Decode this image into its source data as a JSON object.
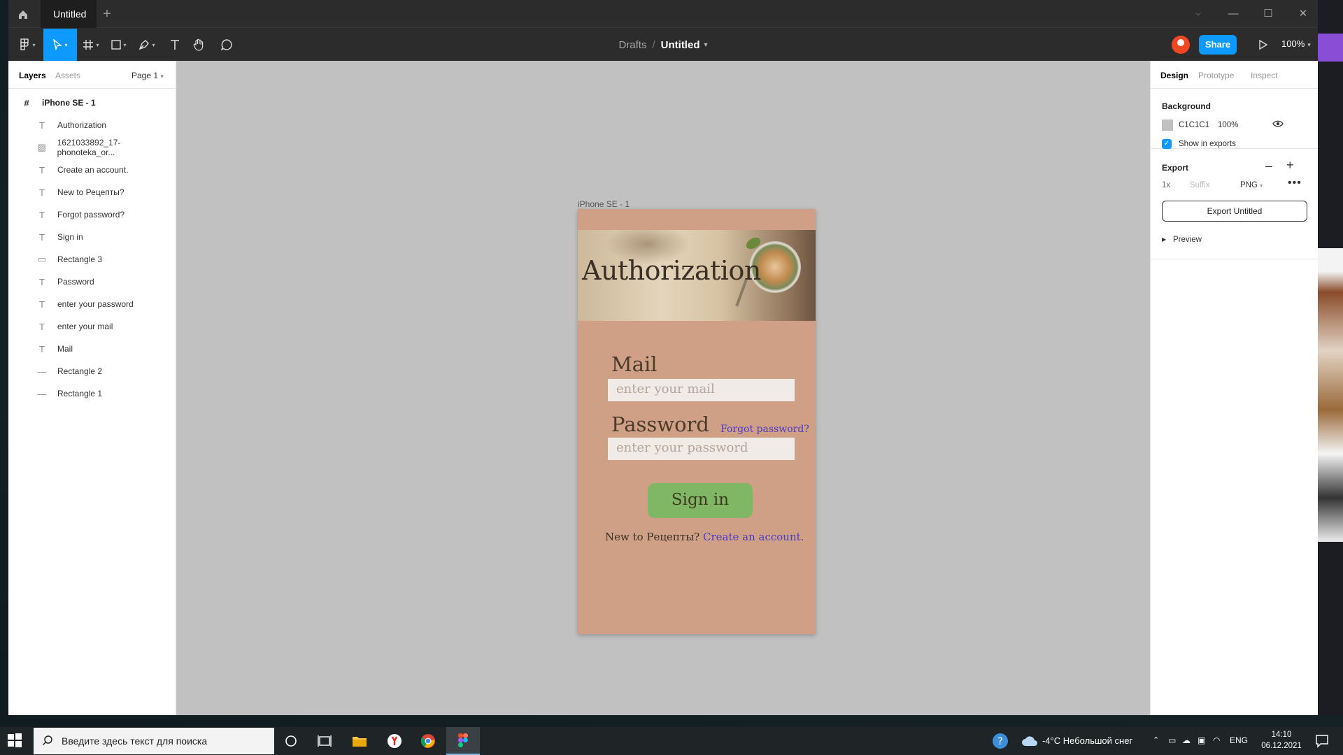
{
  "window": {
    "tab_title": "Untitled",
    "controls": {
      "minimize": "—",
      "maximize": "☐",
      "close": "✕"
    }
  },
  "toolbar": {
    "breadcrumb_drafts": "Drafts",
    "breadcrumb_sep": "/",
    "file_name": "Untitled",
    "share_label": "Share",
    "zoom_label": "100%"
  },
  "left_panel": {
    "tabs": [
      "Layers",
      "Assets"
    ],
    "page_selector": "Page 1",
    "frame_name": "iPhone SE - 1",
    "layers": [
      {
        "name": "Authorization",
        "icon": "text-icon"
      },
      {
        "name": "1621033892_17-phonoteka_or...",
        "icon": "image-icon"
      },
      {
        "name": "Create an account.",
        "icon": "text-icon"
      },
      {
        "name": "New to Рецепты?",
        "icon": "text-icon"
      },
      {
        "name": "Forgot password?",
        "icon": "text-icon"
      },
      {
        "name": "Sign in",
        "icon": "text-icon"
      },
      {
        "name": "Rectangle 3",
        "icon": "rectangle-icon"
      },
      {
        "name": "Password",
        "icon": "text-icon"
      },
      {
        "name": "enter your password",
        "icon": "text-icon"
      },
      {
        "name": "enter your mail",
        "icon": "text-icon"
      },
      {
        "name": "Mail",
        "icon": "text-icon"
      },
      {
        "name": "Rectangle 2",
        "icon": "line-icon"
      },
      {
        "name": "Rectangle 1",
        "icon": "line-icon"
      }
    ]
  },
  "canvas": {
    "background": "#C1C1C1",
    "frame_label": "iPhone SE - 1",
    "design": {
      "title": "Authorization",
      "mail_label": "Mail",
      "mail_placeholder": "enter your mail",
      "password_label": "Password",
      "forgot_link": "Forgot password?",
      "password_placeholder": "enter your password",
      "signin_label": "Sign in",
      "new_to": "New to Рецепты?",
      "create_account": "Create an account."
    },
    "help_label": "?"
  },
  "right_panel": {
    "tabs": [
      "Design",
      "Prototype",
      "Inspect"
    ],
    "background_heading": "Background",
    "bg_hex": "C1C1C1",
    "bg_opacity": "100%",
    "show_in_exports": "Show in exports",
    "export_heading": "Export",
    "export_scale": "1x",
    "export_suffix_placeholder": "Suffix",
    "export_format": "PNG",
    "export_button": "Export Untitled",
    "preview_label": "Preview"
  },
  "taskbar": {
    "search_placeholder": "Введите здесь текст для поиска",
    "weather": "-4°C  Небольшой снег",
    "language": "ENG",
    "time": "14:10",
    "date": "06.12.2021"
  },
  "colors": {
    "accent": "#0d99ff",
    "frame_bg": "#cfa085",
    "signin_green": "#7fb765",
    "link_blue": "#4b3cc6"
  }
}
